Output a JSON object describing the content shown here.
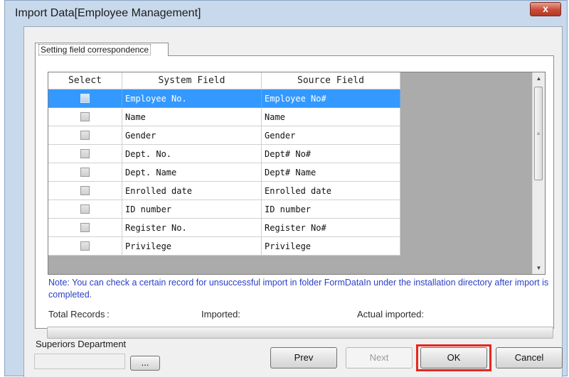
{
  "window": {
    "title": "Import Data[Employee Management]",
    "close_label": "x"
  },
  "tab": {
    "label": "Setting field correspondence"
  },
  "grid": {
    "headers": {
      "select": "Select",
      "system": "System Field",
      "source": "Source Field"
    },
    "rows": [
      {
        "system": "Employee No.",
        "source": "Employee No#",
        "selected": true,
        "checked": false
      },
      {
        "system": "Name",
        "source": "Name",
        "selected": false,
        "checked": false
      },
      {
        "system": "Gender",
        "source": "Gender",
        "selected": false,
        "checked": false
      },
      {
        "system": "Dept. No.",
        "source": "Dept# No#",
        "selected": false,
        "checked": false
      },
      {
        "system": "Dept. Name",
        "source": "Dept# Name",
        "selected": false,
        "checked": false
      },
      {
        "system": "Enrolled date",
        "source": "Enrolled date",
        "selected": false,
        "checked": false
      },
      {
        "system": "ID number",
        "source": "ID number",
        "selected": false,
        "checked": false
      },
      {
        "system": "Register No.",
        "source": "Register No#",
        "selected": false,
        "checked": false
      },
      {
        "system": "Privilege",
        "source": "Privilege",
        "selected": false,
        "checked": false
      }
    ]
  },
  "scrollbar": {
    "up_icon": "▲",
    "down_icon": "▼",
    "grip_icon": "≡"
  },
  "note": "Note: You can check a certain record for unsuccessful import in folder FormDataIn under the installation directory after import is completed.",
  "stats": {
    "total_label": "Total Records :",
    "imported_label": "Imported:",
    "actual_label": "Actual imported:"
  },
  "progress": {
    "value": 0
  },
  "superiors": {
    "label": "Superiors Department",
    "value": "",
    "browse_label": "..."
  },
  "buttons": {
    "prev": "Prev",
    "next": "Next",
    "ok": "OK",
    "cancel": "Cancel"
  },
  "colors": {
    "selection": "#3399ff",
    "highlight": "#e8261f",
    "note": "#2b3ec6"
  }
}
